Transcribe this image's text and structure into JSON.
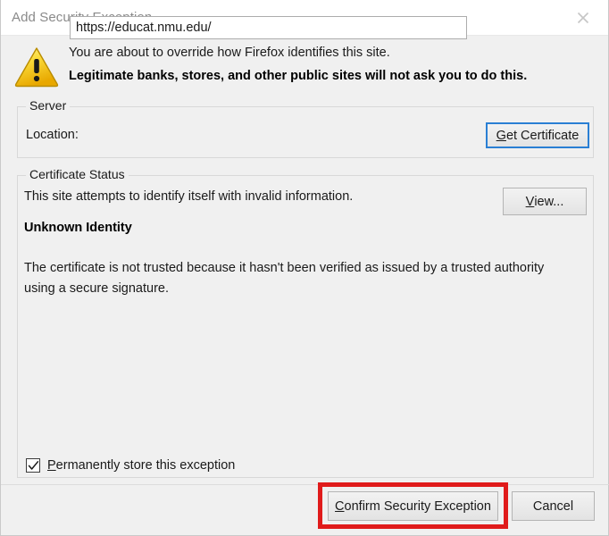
{
  "window": {
    "title": "Add Security Exception",
    "close_icon": "close-icon"
  },
  "warning": {
    "icon": "warning-triangle-icon",
    "line1": "You are about to override how Firefox identifies this site.",
    "line2": "Legitimate banks, stores, and other public sites will not ask you to do this."
  },
  "server": {
    "legend": "Server",
    "location_label": "Location:",
    "location_value": "https://educat.nmu.edu/",
    "location_placeholder": "",
    "get_certificate_accesskey": "G",
    "get_certificate_rest": "et Certificate"
  },
  "certificate_status": {
    "legend": "Certificate Status",
    "invalid_info": "This site attempts to identify itself with invalid information.",
    "view_accesskey": "V",
    "view_rest": "iew...",
    "identity_heading": "Unknown Identity",
    "detail": "The certificate is not trusted because it hasn't been verified as issued by a trusted authority using a secure signature."
  },
  "options": {
    "permanent_accesskey": "P",
    "permanent_rest": "ermanently store this exception",
    "permanent_checked": true,
    "checkmark_icon": "check-icon"
  },
  "footer": {
    "confirm_accesskey": "C",
    "confirm_rest": "onfirm Security Exception",
    "cancel_label": "Cancel"
  },
  "annotation": {
    "highlight_color": "#e01b1b",
    "target": "confirm-security-exception-button"
  },
  "colors": {
    "dialog_background": "#f0f0f0",
    "titlebar_background": "#ffffff",
    "title_text": "#8a8a8a",
    "focus_border": "#2a7fd4",
    "warning_yellow": "#fbd600"
  }
}
